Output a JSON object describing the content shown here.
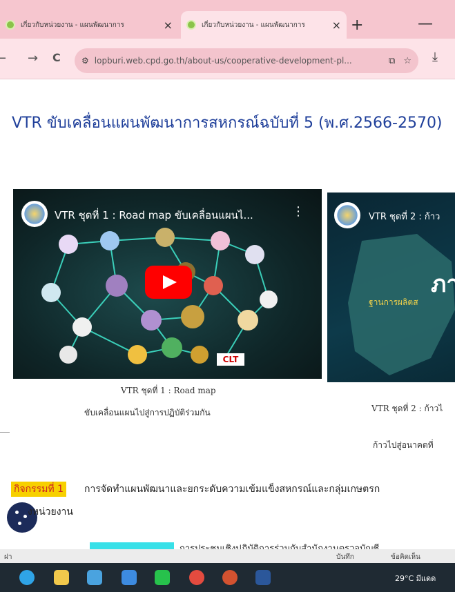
{
  "browser": {
    "tabs": [
      {
        "title": "เกี่ยวกับหน่วยงาน - แผนพัฒนาการ",
        "active": false
      },
      {
        "title": "เกี่ยวกับหน่วยงาน - แผนพัฒนาการ",
        "active": true
      }
    ],
    "new_tab": "+",
    "minimize": "—",
    "url": "lopburi.web.cpd.go.th/about-us/cooperative-development-pl...",
    "nav": {
      "back": "←",
      "forward": "→",
      "reload": "C"
    }
  },
  "page": {
    "title": "VTR ขับเคลื่อนแผนพัฒนาการสหกรณ์ฉบับที่ 5 (พ.ศ.2566-2570)",
    "videos": [
      {
        "overlay_title": "VTR ชุดที่ 1 : Road map ขับเคลื่อนแผนไ...",
        "caption_line1": "VTR ชุดที่ 1 : Road map",
        "caption_line2": "ขับเคลื่อนแผนไปสู่การปฏิบัติร่วมกัน",
        "brand": "CLT"
      },
      {
        "overlay_title": "VTR ชุดที่ 2 : ก้าว",
        "overlay_big": "ภา",
        "overlay_sub": "ฐานการผลิตส",
        "caption_line1": "VTR ชุดที่ 2 : ก้าวไ",
        "caption_line2": "ก้าวไปสู่อนาคตที่"
      }
    ],
    "activity": {
      "label": "กิจกรรมที่ 1",
      "text": "การจัดทำแผนพัฒนาและยกระดับความเข้มแข็งสหกรณ์และกลุ่มเกษตรก",
      "unit": "งหน่วยงาน"
    },
    "cyan_text": "การประชุมเชิงปฏิบัติการร่วมกับสำนักงานตรวจบัญชี"
  },
  "statusbar": {
    "left": "ฝา",
    "items": [
      "บันทึก",
      "ข้อคิดเห็น"
    ]
  },
  "taskbar": {
    "weather": "29°C มีแดด",
    "colors": {
      "bg": "#1f2a33"
    }
  },
  "colors": {
    "tabbar": "#f6c6cf",
    "title_blue": "#1f3f9a",
    "youtube_red": "#ff0000",
    "highlight_yellow": "#f7d000",
    "highlight_cyan": "#38e0e8"
  }
}
